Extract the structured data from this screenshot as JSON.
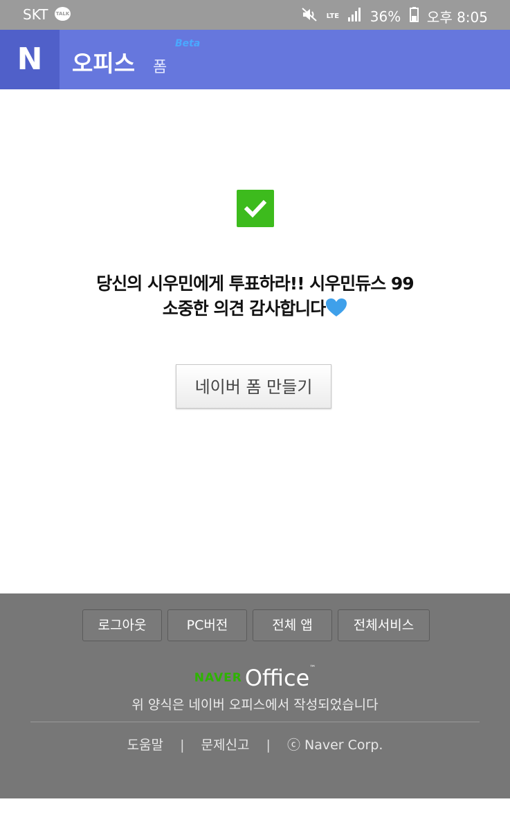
{
  "status_bar": {
    "carrier": "SKT",
    "talk_badge": "TALK",
    "network": "LTE",
    "battery": "36%",
    "time": "오후 8:05",
    "icons": [
      "talk-icon",
      "mute-icon",
      "signal-icon",
      "battery-icon"
    ]
  },
  "header": {
    "logo": "N",
    "title": "오피스",
    "subtitle": "폼",
    "beta": "Beta",
    "background_color": "#6677dd"
  },
  "content": {
    "check_icon": "checkmark-icon",
    "check_color": "#3dbb1d",
    "message_line1": "당신의 시우민에게 투표하라!! 시우민듀스 99",
    "message_line2": "소중한 의견 감사합니다",
    "heart_icon": "blue-heart-icon",
    "create_form_button": "네이버 폼 만들기"
  },
  "footer": {
    "buttons": [
      {
        "label": "로그아웃"
      },
      {
        "label": "PC버전"
      },
      {
        "label": "전체 앱"
      },
      {
        "label": "전체서비스"
      }
    ],
    "brand_naver": "NAVER",
    "brand_office": "Office",
    "brand_tm": "™",
    "description": "위 양식은 네이버 오피스에서 작성되었습니다",
    "links": {
      "help": "도움말",
      "report": "문제신고",
      "copyright": "ⓒ Naver Corp.",
      "separator": "|"
    },
    "brand_color": "#2db400"
  }
}
